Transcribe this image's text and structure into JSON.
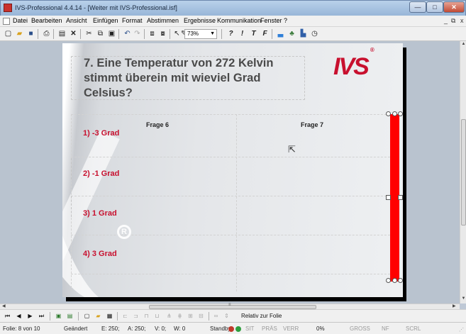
{
  "window": {
    "title": "IVS-Professional 4.4.14 - [Weiter mit IVS-Professional.isf]",
    "min_glyph": "—",
    "max_glyph": "□",
    "close_glyph": "✕"
  },
  "menu": {
    "items": [
      "Datei",
      "Bearbeiten",
      "Ansicht",
      "Einfügen",
      "Format",
      "Abstimmen",
      "Ergebnisse",
      "Kommunikation",
      "Fenster",
      "?"
    ],
    "mdi": [
      "_",
      "⧉",
      "x"
    ]
  },
  "toolbar": {
    "icons": [
      "new-icon",
      "open-icon",
      "save-icon",
      "print-icon",
      "properties-icon",
      "delete-icon",
      "cut-icon",
      "copy-icon",
      "paste-icon",
      "undo-icon",
      "redo-icon",
      "slide-copy-icon",
      "slide-paste-icon",
      "pointer-icon",
      "pen-icon"
    ],
    "zoom": "73%",
    "format_buttons": [
      "?",
      "!",
      "T",
      "F"
    ],
    "right_icons": [
      "chart-icon",
      "group-icon",
      "bars-icon",
      "timer-icon"
    ]
  },
  "slide": {
    "question": "7. Eine Temperatur von 272 Kelvin stimmt überein mit wieviel Grad Celsius?",
    "logo_text": "IVS",
    "logo_mark": "®",
    "answers": [
      "1) -3 Grad",
      "2) -1 Grad",
      "3) 1 Grad",
      "4) 3 Grad"
    ],
    "watermark_mark": "R"
  },
  "chart_data": {
    "type": "bar",
    "categories": [
      "Frage 6",
      "Frage 7"
    ],
    "series": [
      {
        "values": [
          0,
          100
        ]
      }
    ],
    "ylim": [
      0,
      100
    ],
    "grid": true,
    "bar_color": "#ff0000"
  },
  "nav": {
    "buttons": [
      "first-icon",
      "prev-icon",
      "next-icon",
      "last-icon"
    ],
    "label": "Relativ zur Folie"
  },
  "status": {
    "slide": "Folie: 8 von 10",
    "state": "Geändert",
    "e_val": "E: 250;",
    "a_val": "A: 250;",
    "v_val": "V: 0;",
    "w_val": "W: 0",
    "mode": "Standby",
    "sit": "SIT",
    "pras": "PRÄS",
    "verr": "VERR",
    "percent": "0%",
    "gross": "GROSS",
    "nf": "NF",
    "scrl": "SCRL"
  },
  "colors": {
    "accent": "#c8102e",
    "bar": "#ff0000",
    "led_red": "#c0392b",
    "led_green": "#2e9e3e"
  }
}
